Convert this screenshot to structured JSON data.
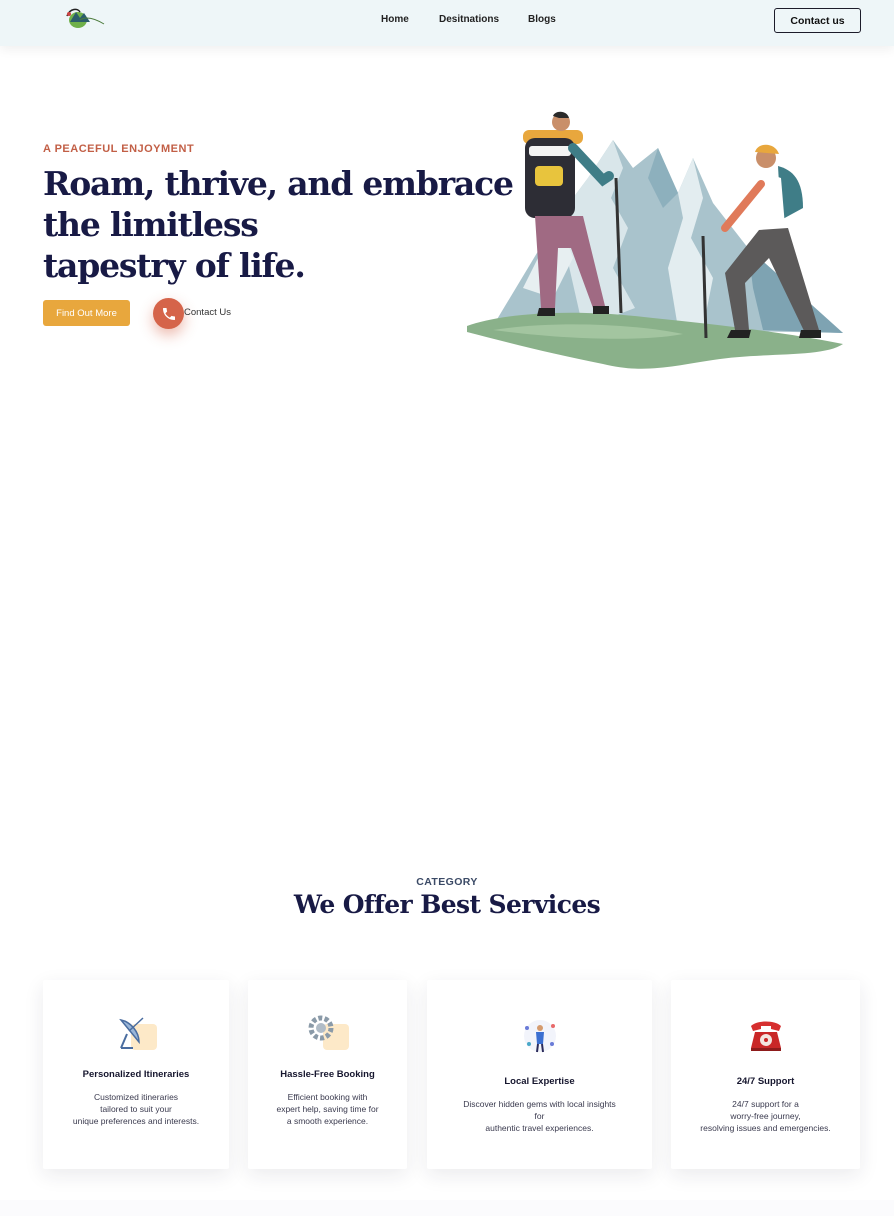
{
  "header": {
    "logo_icon": "mountain-logo-icon",
    "nav": [
      {
        "label": "Home"
      },
      {
        "label": "Desitnations"
      },
      {
        "label": "Blogs"
      }
    ],
    "contact_label": "Contact us"
  },
  "hero": {
    "eyebrow": "A PEACEFUL ENJOYMENT",
    "title_lines": [
      "Roam, thrive, and embrace",
      "the limitless",
      "tapestry of life."
    ],
    "primary_button": "Find Out More",
    "phone_icon": "phone-icon",
    "contact_link": "Contact Us",
    "illustration": "hikers-mountains-illustration"
  },
  "services": {
    "eyebrow": "CATEGORY",
    "title": "We Offer Best Services",
    "cards": [
      {
        "icon": "satellite-dish-icon",
        "title": "Personalized Itineraries",
        "desc": [
          "Customized itineraries",
          "tailored to suit your",
          "unique preferences and interests."
        ]
      },
      {
        "icon": "gear-icon",
        "title": "Hassle-Free Booking",
        "desc": [
          "Efficient booking with",
          "expert help, saving time for",
          "a smooth experience."
        ]
      },
      {
        "icon": "local-guide-icon",
        "title": "Local Expertise",
        "desc": [
          "Discover hidden gems with local insights",
          "for",
          "authentic travel experiences."
        ]
      },
      {
        "icon": "telephone-icon",
        "title": "24/7 Support",
        "desc": [
          "24/7 support for a",
          "worry-free journey,",
          "resolving issues and emergencies."
        ]
      }
    ]
  },
  "colors": {
    "accent_orange": "#e8a73d",
    "eyebrow_red": "#c25f46",
    "phone_red": "#d5644a",
    "navy": "#181a45",
    "header_bg": "#eef6f8"
  }
}
